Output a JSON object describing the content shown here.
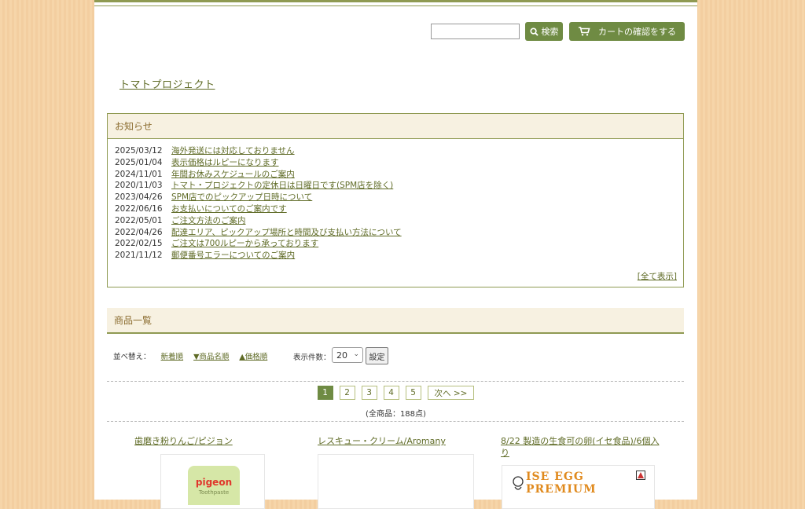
{
  "header": {
    "search_value": "",
    "search_label": "検索",
    "cart_label": "カートの確認をする"
  },
  "site": {
    "name": "トマトプロジェクト"
  },
  "news": {
    "heading": "お知らせ",
    "items": [
      {
        "date": "2025/03/12",
        "title": "海外発送には対応しておりません"
      },
      {
        "date": "2025/01/04",
        "title": "表示価格はルピーになります"
      },
      {
        "date": "2024/11/01",
        "title": "年間お休みスケジュールのご案内"
      },
      {
        "date": "2020/11/03",
        "title": "トマト・プロジェクトの定休日は日曜日です(SPM店を除く)"
      },
      {
        "date": "2023/04/26",
        "title": "SPM店でのピックアップ日時について"
      },
      {
        "date": "2022/06/16",
        "title": "お支払いについてのご案内です"
      },
      {
        "date": "2022/05/01",
        "title": "ご注文方法のご案内"
      },
      {
        "date": "2022/04/26",
        "title": "配達エリア、ピックアップ場所と時間及び支払い方法について"
      },
      {
        "date": "2022/02/15",
        "title": "ご注文は700ルピーから承っております"
      },
      {
        "date": "2021/11/12",
        "title": "郵便番号エラーについてのご案内"
      }
    ],
    "view_all": "[全て表示]"
  },
  "products": {
    "heading": "商品一覧",
    "sort_label": "並べ替え：",
    "sort_options": [
      "新着順",
      "▼商品名順",
      "▲価格順"
    ],
    "count_label": "表示件数：",
    "count_value": "20",
    "set_label": "設定",
    "pages": [
      "1",
      "2",
      "3",
      "4",
      "5"
    ],
    "next_label": "次へ >>",
    "total": "(全商品：188点)",
    "items": [
      {
        "name": "歯磨き粉りんご/ピジョン",
        "img_text": "pigeon",
        "img_sub": "Toothpaste"
      },
      {
        "name": "レスキュー・クリーム/Aromany"
      },
      {
        "name": "8/22 製造の生食可の卵(イセ食品)/6個入り",
        "img_text": "ISE EGG PREMIUM"
      }
    ]
  },
  "colors": {
    "accent": "#6f8b43",
    "border": "#8f9a52",
    "header_bg": "#f7f1e1",
    "heading_text": "#8a6b2e"
  }
}
